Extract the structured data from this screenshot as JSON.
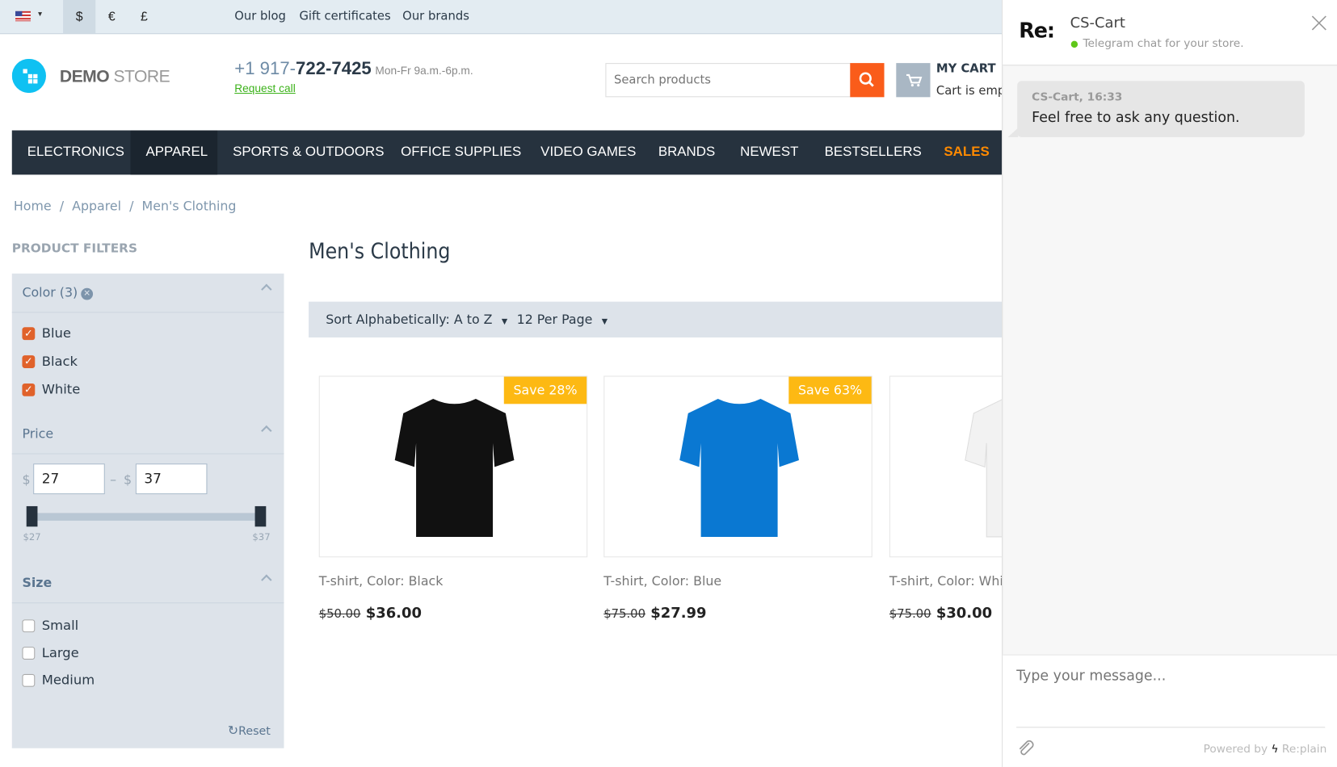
{
  "topbar": {
    "currencies": [
      "$",
      "€",
      "£"
    ],
    "active_currency": "$",
    "links": [
      "Our blog",
      "Gift certificates",
      "Our brands"
    ]
  },
  "header": {
    "logo_bold": "DEMO",
    "logo_light": "STORE",
    "phone_prefix": "+1 917-",
    "phone_main": "722-7425",
    "hours": "Mon-Fr 9a.m.-6p.m.",
    "request_call": "Request call",
    "search_placeholder": "Search products",
    "cart_title": "MY CART",
    "cart_status": "Cart is empty"
  },
  "nav": {
    "items": [
      "ELECTRONICS",
      "APPAREL",
      "SPORTS & OUTDOORS",
      "OFFICE SUPPLIES",
      "VIDEO GAMES",
      "BRANDS",
      "NEWEST",
      "BESTSELLERS",
      "SALES"
    ],
    "active": "APPAREL",
    "highlight_color": "#ff8a00"
  },
  "breadcrumb": [
    "Home",
    "Apparel",
    "Men's Clothing"
  ],
  "filters": {
    "title": "PRODUCT FILTERS",
    "color": {
      "label": "Color (3)",
      "options": [
        "Blue",
        "Black",
        "White"
      ]
    },
    "price": {
      "label": "Price",
      "currency": "$",
      "min": "27",
      "max": "37",
      "min_label": "$27",
      "max_label": "$37"
    },
    "size": {
      "label": "Size",
      "options": [
        "Small",
        "Large",
        "Medium"
      ]
    },
    "reset": "Reset"
  },
  "main": {
    "title": "Men's Clothing",
    "sort": "Sort Alphabetically: A to Z",
    "per_page": "12 Per Page",
    "products": [
      {
        "name": "T-shirt, Color: Black",
        "old_price": "$50.00",
        "price": "$36.00",
        "badge": "Save 28%",
        "color": "#111111"
      },
      {
        "name": "T-shirt, Color: Blue",
        "old_price": "$75.00",
        "price": "$27.99",
        "badge": "Save 63%",
        "color": "#0a78d2"
      },
      {
        "name": "T-shirt, Color: White",
        "old_price": "$75.00",
        "price": "$30.00",
        "color": "#f2f2f2"
      }
    ]
  },
  "chat": {
    "logo": "Re:",
    "title": "CS-Cart",
    "subtitle": "Telegram chat for your store.",
    "message_meta": "CS-Cart, 16:33",
    "message": "Feel free to ask any question.",
    "input_placeholder": "Type your message...",
    "powered_by": "Powered by",
    "brand": "Re:plain"
  }
}
